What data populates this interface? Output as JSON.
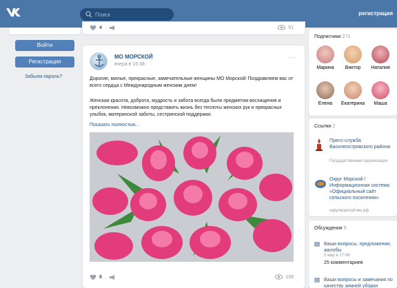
{
  "header": {
    "search_placeholder": "Поиск",
    "register_link": "регистрация"
  },
  "left_panel": {
    "login_button": "Войти",
    "register_button": "Регистрация",
    "forgot_password": "Забыли пароль?"
  },
  "previous_post": {
    "likes": "4",
    "views": "51"
  },
  "post": {
    "author": "МО МОРСКОЙ",
    "time": "вчера в 15:38",
    "paragraph1": "Дорогие, милые, прекрасные, замечательные женщины МО Морской! Поздравляем вас от всего сердца с Международным женским днем!",
    "paragraph2": "Женская красота, доброта, мудрость и забота всегда были предметом восхищения и преклонения. Невозможно представить жизнь без теплоты женских рук и прекрасных улыбок, материнской заботы, сестринской поддержки.",
    "show_more": "Показать полностью...",
    "likes": "8",
    "views": "108"
  },
  "subscribers": {
    "title": "Подписчики",
    "count": "271",
    "people": [
      {
        "name": "Марина",
        "color": "#c97a8a"
      },
      {
        "name": "Виктор",
        "color": "#d89a6a"
      },
      {
        "name": "Наталия",
        "color": "#b24a5a"
      },
      {
        "name": "Елена",
        "color": "#8a6a5a"
      },
      {
        "name": "Екатерина",
        "color": "#c98a6a"
      },
      {
        "name": "Маша",
        "color": "#d24a6a"
      }
    ]
  },
  "links": {
    "title": "Ссылки",
    "count": "2",
    "items": [
      {
        "title": "Пресс-служба Василеостровского района",
        "subtitle": "Государственная организация"
      },
      {
        "title": "Округ Морской / Информационная система «Официальный сайт сельского поселения»",
        "subtitle": "округморской-мо.рф"
      }
    ]
  },
  "discussions": {
    "title": "Обсуждения",
    "count": "5",
    "items": [
      {
        "title": "Ваши вопросы, предложения, жалобы",
        "meta": "5 мар в 17:06",
        "comments": "25 комментариев"
      },
      {
        "title": "Ваши вопросы и замечания по качеству зимней уборки"
      }
    ]
  },
  "colors": {
    "header": "#4a76a8",
    "button": "#5181b8",
    "link": "#2a5885"
  }
}
